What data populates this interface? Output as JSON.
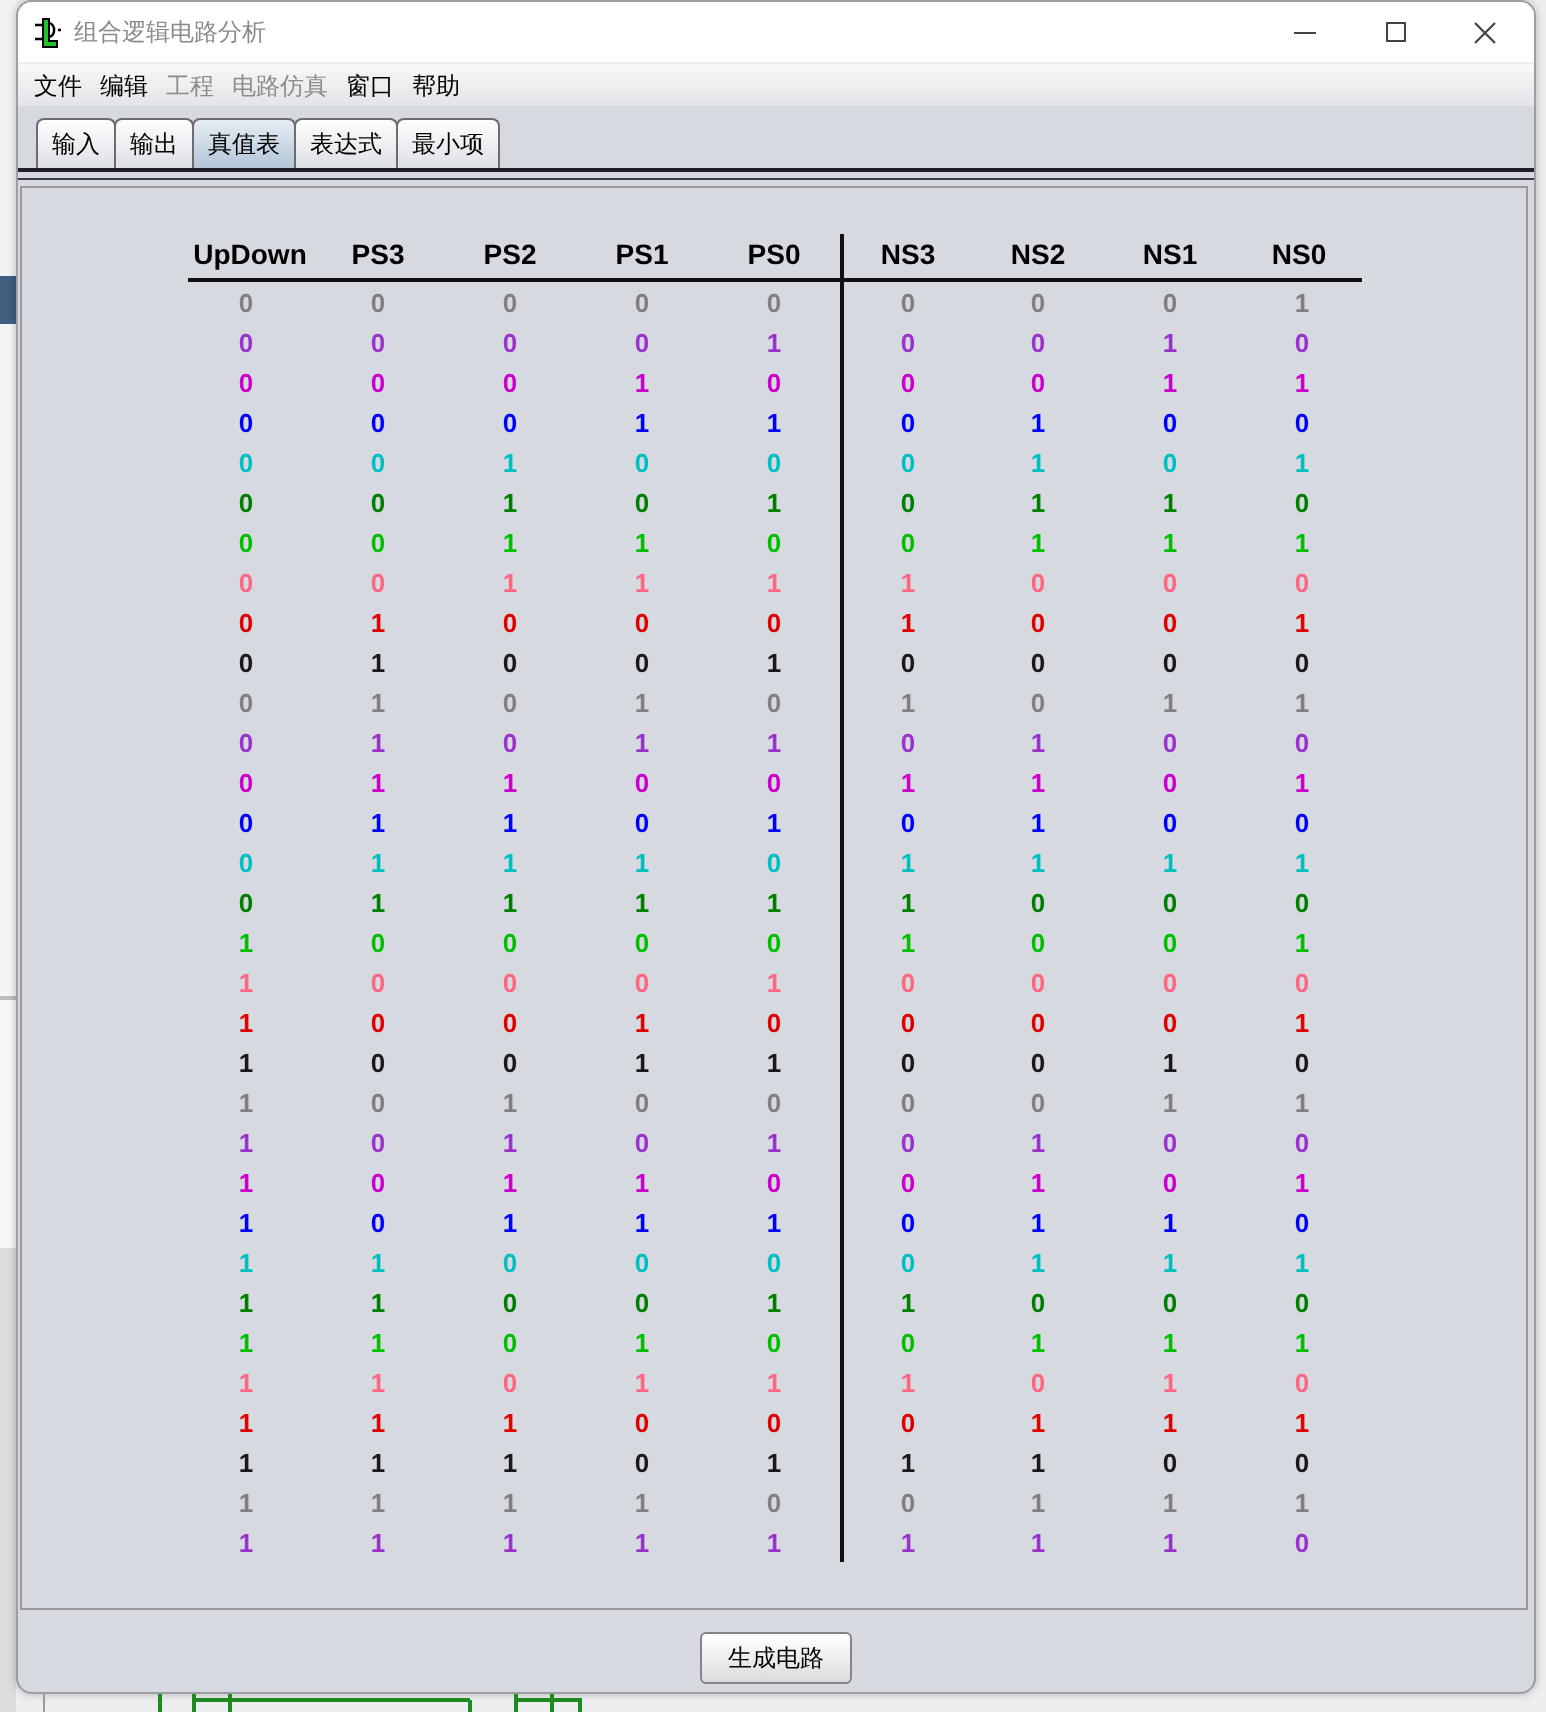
{
  "window": {
    "title": "组合逻辑电路分析"
  },
  "menu": [
    {
      "label": "文件",
      "disabled": false
    },
    {
      "label": "编辑",
      "disabled": false
    },
    {
      "label": "工程",
      "disabled": true
    },
    {
      "label": "电路仿真",
      "disabled": true
    },
    {
      "label": "窗口",
      "disabled": false
    },
    {
      "label": "帮助",
      "disabled": false
    }
  ],
  "tabs": [
    {
      "label": "输入",
      "selected": false
    },
    {
      "label": "输出",
      "selected": false
    },
    {
      "label": "真值表",
      "selected": true
    },
    {
      "label": "表达式",
      "selected": false
    },
    {
      "label": "最小项",
      "selected": false
    }
  ],
  "truth_table": {
    "input_columns": [
      "UpDown",
      "PS3",
      "PS2",
      "PS1",
      "PS0"
    ],
    "output_columns": [
      "NS3",
      "NS2",
      "NS1",
      "NS0"
    ],
    "rows": [
      {
        "color": "#808080",
        "inputs": [
          "0",
          "0",
          "0",
          "0",
          "0"
        ],
        "outputs": [
          "0",
          "0",
          "0",
          "1"
        ]
      },
      {
        "color": "#9933cc",
        "inputs": [
          "0",
          "0",
          "0",
          "0",
          "1"
        ],
        "outputs": [
          "0",
          "0",
          "1",
          "0"
        ]
      },
      {
        "color": "#cc00cc",
        "inputs": [
          "0",
          "0",
          "0",
          "1",
          "0"
        ],
        "outputs": [
          "0",
          "0",
          "1",
          "1"
        ]
      },
      {
        "color": "#0000ff",
        "inputs": [
          "0",
          "0",
          "0",
          "1",
          "1"
        ],
        "outputs": [
          "0",
          "1",
          "0",
          "0"
        ]
      },
      {
        "color": "#00bfbf",
        "inputs": [
          "0",
          "0",
          "1",
          "0",
          "0"
        ],
        "outputs": [
          "0",
          "1",
          "0",
          "1"
        ]
      },
      {
        "color": "#008000",
        "inputs": [
          "0",
          "0",
          "1",
          "0",
          "1"
        ],
        "outputs": [
          "0",
          "1",
          "1",
          "0"
        ]
      },
      {
        "color": "#00c000",
        "inputs": [
          "0",
          "0",
          "1",
          "1",
          "0"
        ],
        "outputs": [
          "0",
          "1",
          "1",
          "1"
        ]
      },
      {
        "color": "#ff6680",
        "inputs": [
          "0",
          "0",
          "1",
          "1",
          "1"
        ],
        "outputs": [
          "1",
          "0",
          "0",
          "0"
        ]
      },
      {
        "color": "#e00000",
        "inputs": [
          "0",
          "1",
          "0",
          "0",
          "0"
        ],
        "outputs": [
          "1",
          "0",
          "0",
          "1"
        ]
      },
      {
        "color": "#1a1a1a",
        "inputs": [
          "0",
          "1",
          "0",
          "0",
          "1"
        ],
        "outputs": [
          "0",
          "0",
          "0",
          "0"
        ]
      },
      {
        "color": "#808080",
        "inputs": [
          "0",
          "1",
          "0",
          "1",
          "0"
        ],
        "outputs": [
          "1",
          "0",
          "1",
          "1"
        ]
      },
      {
        "color": "#9933cc",
        "inputs": [
          "0",
          "1",
          "0",
          "1",
          "1"
        ],
        "outputs": [
          "0",
          "1",
          "0",
          "0"
        ]
      },
      {
        "color": "#cc00cc",
        "inputs": [
          "0",
          "1",
          "1",
          "0",
          "0"
        ],
        "outputs": [
          "1",
          "1",
          "0",
          "1"
        ]
      },
      {
        "color": "#0000ff",
        "inputs": [
          "0",
          "1",
          "1",
          "0",
          "1"
        ],
        "outputs": [
          "0",
          "1",
          "0",
          "0"
        ]
      },
      {
        "color": "#00bfbf",
        "inputs": [
          "0",
          "1",
          "1",
          "1",
          "0"
        ],
        "outputs": [
          "1",
          "1",
          "1",
          "1"
        ]
      },
      {
        "color": "#008000",
        "inputs": [
          "0",
          "1",
          "1",
          "1",
          "1"
        ],
        "outputs": [
          "1",
          "0",
          "0",
          "0"
        ]
      },
      {
        "color": "#00c000",
        "inputs": [
          "1",
          "0",
          "0",
          "0",
          "0"
        ],
        "outputs": [
          "1",
          "0",
          "0",
          "1"
        ]
      },
      {
        "color": "#ff6680",
        "inputs": [
          "1",
          "0",
          "0",
          "0",
          "1"
        ],
        "outputs": [
          "0",
          "0",
          "0",
          "0"
        ]
      },
      {
        "color": "#e00000",
        "inputs": [
          "1",
          "0",
          "0",
          "1",
          "0"
        ],
        "outputs": [
          "0",
          "0",
          "0",
          "1"
        ]
      },
      {
        "color": "#1a1a1a",
        "inputs": [
          "1",
          "0",
          "0",
          "1",
          "1"
        ],
        "outputs": [
          "0",
          "0",
          "1",
          "0"
        ]
      },
      {
        "color": "#808080",
        "inputs": [
          "1",
          "0",
          "1",
          "0",
          "0"
        ],
        "outputs": [
          "0",
          "0",
          "1",
          "1"
        ]
      },
      {
        "color": "#9933cc",
        "inputs": [
          "1",
          "0",
          "1",
          "0",
          "1"
        ],
        "outputs": [
          "0",
          "1",
          "0",
          "0"
        ]
      },
      {
        "color": "#cc00cc",
        "inputs": [
          "1",
          "0",
          "1",
          "1",
          "0"
        ],
        "outputs": [
          "0",
          "1",
          "0",
          "1"
        ]
      },
      {
        "color": "#0000ff",
        "inputs": [
          "1",
          "0",
          "1",
          "1",
          "1"
        ],
        "outputs": [
          "0",
          "1",
          "1",
          "0"
        ]
      },
      {
        "color": "#00bfbf",
        "inputs": [
          "1",
          "1",
          "0",
          "0",
          "0"
        ],
        "outputs": [
          "0",
          "1",
          "1",
          "1"
        ]
      },
      {
        "color": "#008000",
        "inputs": [
          "1",
          "1",
          "0",
          "0",
          "1"
        ],
        "outputs": [
          "1",
          "0",
          "0",
          "0"
        ]
      },
      {
        "color": "#00c000",
        "inputs": [
          "1",
          "1",
          "0",
          "1",
          "0"
        ],
        "outputs": [
          "0",
          "1",
          "1",
          "1"
        ]
      },
      {
        "color": "#ff6680",
        "inputs": [
          "1",
          "1",
          "0",
          "1",
          "1"
        ],
        "outputs": [
          "1",
          "0",
          "1",
          "0"
        ]
      },
      {
        "color": "#e00000",
        "inputs": [
          "1",
          "1",
          "1",
          "0",
          "0"
        ],
        "outputs": [
          "0",
          "1",
          "1",
          "1"
        ]
      },
      {
        "color": "#1a1a1a",
        "inputs": [
          "1",
          "1",
          "1",
          "0",
          "1"
        ],
        "outputs": [
          "1",
          "1",
          "0",
          "0"
        ]
      },
      {
        "color": "#808080",
        "inputs": [
          "1",
          "1",
          "1",
          "1",
          "0"
        ],
        "outputs": [
          "0",
          "1",
          "1",
          "1"
        ]
      },
      {
        "color": "#9933cc",
        "inputs": [
          "1",
          "1",
          "1",
          "1",
          "1"
        ],
        "outputs": [
          "1",
          "1",
          "1",
          "0"
        ]
      }
    ]
  },
  "buttons": [
    "生成电路"
  ]
}
